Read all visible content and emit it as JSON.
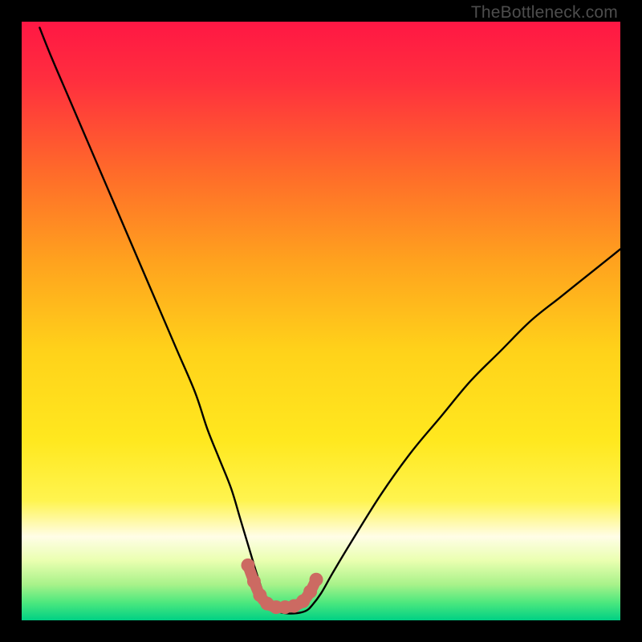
{
  "watermark": "TheBottleneck.com",
  "chart_data": {
    "type": "line",
    "title": "",
    "xlabel": "",
    "ylabel": "",
    "xlim": [
      0,
      100
    ],
    "ylim": [
      0,
      100
    ],
    "grid": false,
    "gradient_stops": [
      {
        "offset": 0.0,
        "color": "#ff1744"
      },
      {
        "offset": 0.1,
        "color": "#ff2f3e"
      },
      {
        "offset": 0.25,
        "color": "#ff6a2a"
      },
      {
        "offset": 0.4,
        "color": "#ffa21e"
      },
      {
        "offset": 0.55,
        "color": "#ffd21a"
      },
      {
        "offset": 0.7,
        "color": "#ffe81f"
      },
      {
        "offset": 0.8,
        "color": "#fff44f"
      },
      {
        "offset": 0.86,
        "color": "#fffde7"
      },
      {
        "offset": 0.9,
        "color": "#eaffb0"
      },
      {
        "offset": 0.94,
        "color": "#a8f28a"
      },
      {
        "offset": 0.97,
        "color": "#4de87e"
      },
      {
        "offset": 1.0,
        "color": "#00d084"
      }
    ],
    "series": [
      {
        "name": "bottleneck-curve",
        "x": [
          3,
          5,
          8,
          11,
          14,
          17,
          20,
          23,
          26,
          29,
          31,
          33,
          35,
          36.5,
          38,
          39.2,
          40.2,
          41,
          42,
          44,
          46,
          47.5,
          48.5,
          50,
          52,
          55,
          60,
          65,
          70,
          75,
          80,
          85,
          90,
          95,
          100
        ],
        "y": [
          99,
          94,
          87,
          80,
          73,
          66,
          59,
          52,
          45,
          38,
          32,
          27,
          22,
          17,
          12,
          8,
          5,
          3,
          1.8,
          1.2,
          1.2,
          1.6,
          2.5,
          4.5,
          8,
          13,
          21,
          28,
          34,
          40,
          45,
          50,
          54,
          58,
          62
        ]
      }
    ],
    "highlight_segment": {
      "name": "bottom-marker",
      "color": "#cc6a62",
      "points": [
        {
          "x": 37.8,
          "y": 9.2
        },
        {
          "x": 38.8,
          "y": 6.5
        },
        {
          "x": 39.8,
          "y": 4.2
        },
        {
          "x": 41.0,
          "y": 2.8
        },
        {
          "x": 42.5,
          "y": 2.2
        },
        {
          "x": 44.0,
          "y": 2.2
        },
        {
          "x": 45.5,
          "y": 2.4
        },
        {
          "x": 47.0,
          "y": 3.2
        },
        {
          "x": 48.2,
          "y": 4.8
        },
        {
          "x": 49.2,
          "y": 6.8
        }
      ]
    }
  }
}
